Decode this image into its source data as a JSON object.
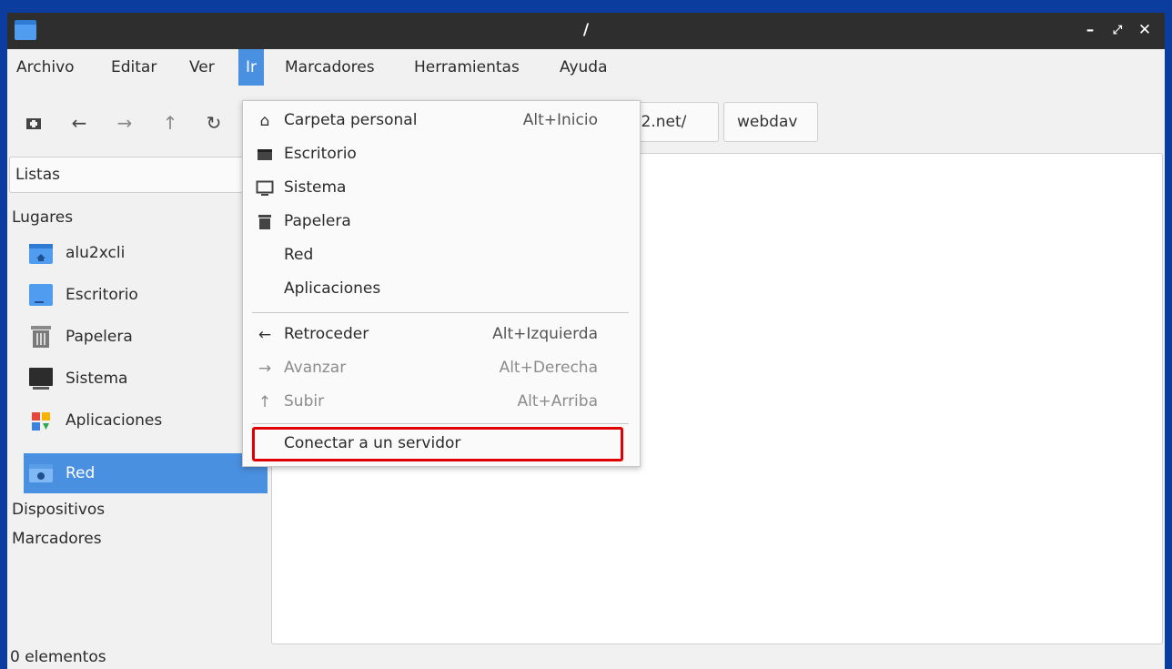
{
  "window": {
    "title": "/"
  },
  "menubar": {
    "items": [
      "Archivo",
      "Editar",
      "Ver",
      "Ir",
      "Marcadores",
      "Herramientas",
      "Ayuda"
    ],
    "active": "Ir"
  },
  "toolbar": {
    "new_tab_icon": "new-tab-icon",
    "back_icon": "back-arrow-icon",
    "forward_icon": "forward-arrow-icon",
    "up_icon": "up-arrow-icon",
    "reload_icon": "reload-icon",
    "path_segments": [
      "j22.net/",
      "webdav"
    ]
  },
  "sidebar": {
    "view_mode": "Listas",
    "places_header": "Lugares",
    "places": [
      {
        "label": "alu2xcli",
        "icon": "home-folder-icon"
      },
      {
        "label": "Escritorio",
        "icon": "desktop-icon"
      },
      {
        "label": "Papelera",
        "icon": "trash-icon"
      },
      {
        "label": "Sistema",
        "icon": "computer-icon"
      },
      {
        "label": "Aplicaciones",
        "icon": "applications-icon"
      },
      {
        "label": "Red",
        "icon": "network-folder-icon",
        "selected": true
      }
    ],
    "devices_header": "Dispositivos",
    "bookmarks_header": "Marcadores"
  },
  "status": {
    "text": "0 elementos"
  },
  "go_menu": {
    "items": [
      {
        "label": "Carpeta personal",
        "shortcut": "Alt+Inicio",
        "icon": "home-icon"
      },
      {
        "label": "Escritorio",
        "shortcut": "",
        "icon": "desktop-icon"
      },
      {
        "label": "Sistema",
        "shortcut": "",
        "icon": "monitor-icon"
      },
      {
        "label": "Papelera",
        "shortcut": "",
        "icon": "trash-icon"
      },
      {
        "label": "Red",
        "shortcut": "",
        "icon": ""
      },
      {
        "label": "Aplicaciones",
        "shortcut": "",
        "icon": ""
      },
      {
        "label": "Retroceder",
        "shortcut": "Alt+Izquierda",
        "icon": "back-arrow-icon"
      },
      {
        "label": "Avanzar",
        "shortcut": "Alt+Derecha",
        "icon": "forward-arrow-icon",
        "disabled": true
      },
      {
        "label": "Subir",
        "shortcut": "Alt+Arriba",
        "icon": "up-arrow-icon",
        "disabled": true
      },
      {
        "label": "Conectar a un servidor",
        "shortcut": "",
        "icon": "",
        "highlighted": true
      }
    ]
  },
  "colors": {
    "accent": "#4a90e0",
    "highlight_border": "#e00000",
    "titlebar": "#2e2e2e",
    "desktop": "#0a3d9e"
  }
}
